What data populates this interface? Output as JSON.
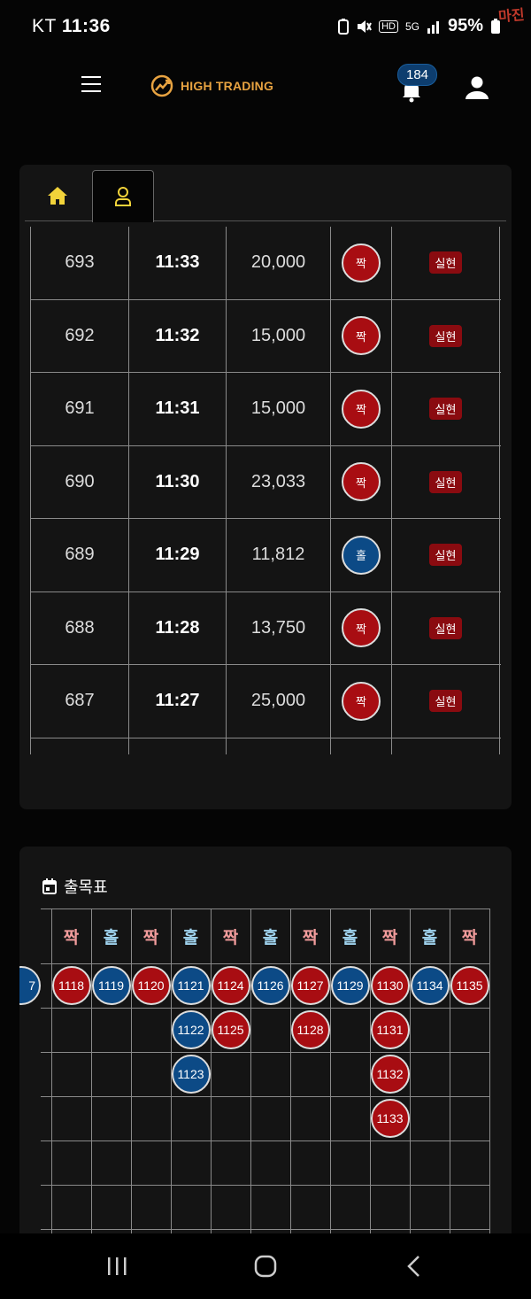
{
  "status_bar": {
    "carrier": "KT",
    "time": "11:36",
    "battery": "95%",
    "network": "5G",
    "hd": "HD",
    "watermark": "마진"
  },
  "header": {
    "brand": "HIGH TRADING",
    "notification_count": "184"
  },
  "tabs": [
    {
      "icon": "home-icon"
    },
    {
      "icon": "user-icon"
    }
  ],
  "history": {
    "rows": [
      {
        "round": "693",
        "time": "11:33",
        "amount": "20,000",
        "pick": "짝",
        "pick_color": "red",
        "result": "실현"
      },
      {
        "round": "692",
        "time": "11:32",
        "amount": "15,000",
        "pick": "짝",
        "pick_color": "red",
        "result": "실현"
      },
      {
        "round": "691",
        "time": "11:31",
        "amount": "15,000",
        "pick": "짝",
        "pick_color": "red",
        "result": "실현"
      },
      {
        "round": "690",
        "time": "11:30",
        "amount": "23,033",
        "pick": "짝",
        "pick_color": "red",
        "result": "실현"
      },
      {
        "round": "689",
        "time": "11:29",
        "amount": "11,812",
        "pick": "홀",
        "pick_color": "blue",
        "result": "실현"
      },
      {
        "round": "688",
        "time": "11:28",
        "amount": "13,750",
        "pick": "짝",
        "pick_color": "red",
        "result": "실현"
      },
      {
        "round": "687",
        "time": "11:27",
        "amount": "25,000",
        "pick": "짝",
        "pick_color": "red",
        "result": "실현"
      }
    ]
  },
  "chart_board": {
    "title": "출목표",
    "prev_partial": "7",
    "columns": [
      {
        "label": "짝",
        "color": "red",
        "items": [
          "1118"
        ]
      },
      {
        "label": "홀",
        "color": "blue",
        "items": [
          "1119"
        ]
      },
      {
        "label": "짝",
        "color": "red",
        "items": [
          "1120"
        ]
      },
      {
        "label": "홀",
        "color": "blue",
        "items": [
          "1121",
          "1122",
          "1123"
        ]
      },
      {
        "label": "짝",
        "color": "red",
        "items": [
          "1124",
          "1125"
        ]
      },
      {
        "label": "홀",
        "color": "blue",
        "items": [
          "1126"
        ]
      },
      {
        "label": "짝",
        "color": "red",
        "items": [
          "1127",
          "1128"
        ]
      },
      {
        "label": "홀",
        "color": "blue",
        "items": [
          "1129"
        ]
      },
      {
        "label": "짝",
        "color": "red",
        "items": [
          "1130",
          "1131",
          "1132",
          "1133"
        ]
      },
      {
        "label": "홀",
        "color": "blue",
        "items": [
          "1134"
        ]
      },
      {
        "label": "짝",
        "color": "red",
        "items": [
          "1135"
        ]
      }
    ]
  }
}
